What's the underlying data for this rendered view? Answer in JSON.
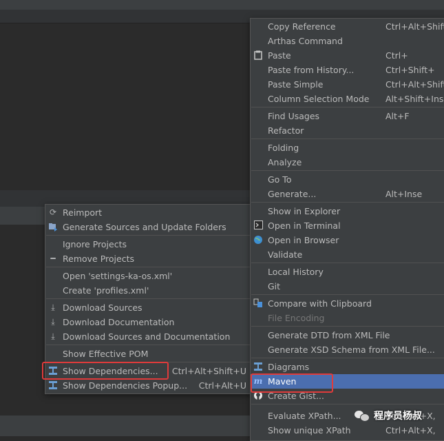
{
  "left_menu": {
    "items": [
      {
        "label": "Reimport",
        "icon": "refresh-icon",
        "shortcut": ""
      },
      {
        "label": "Generate Sources and Update Folders",
        "icon": "generate-folder-icon",
        "shortcut": ""
      },
      {
        "label": "Ignore Projects",
        "icon": "",
        "shortcut": ""
      },
      {
        "label": "Remove Projects",
        "icon": "minus-icon",
        "shortcut": ""
      },
      {
        "label": "Open 'settings-ka-os.xml'",
        "icon": "",
        "shortcut": ""
      },
      {
        "label": "Create 'profiles.xml'",
        "icon": "",
        "shortcut": ""
      },
      {
        "label": "Download Sources",
        "icon": "download-icon",
        "shortcut": ""
      },
      {
        "label": "Download Documentation",
        "icon": "download-icon",
        "shortcut": ""
      },
      {
        "label": "Download Sources and Documentation",
        "icon": "download-icon",
        "shortcut": ""
      },
      {
        "label": "Show Effective POM",
        "icon": "",
        "shortcut": ""
      },
      {
        "label": "Show Dependencies...",
        "icon": "dependencies-icon",
        "shortcut": "Ctrl+Alt+Shift+U"
      },
      {
        "label": "Show Dependencies Popup...",
        "icon": "dependencies-icon",
        "shortcut": "Ctrl+Alt+U"
      }
    ]
  },
  "right_menu": {
    "items": [
      {
        "label": "Copy Reference",
        "shortcut": "Ctrl+Alt+Shift+"
      },
      {
        "label": "Arthas Command",
        "shortcut": ""
      },
      {
        "label": "Paste",
        "shortcut": "Ctrl+"
      },
      {
        "label": "Paste from History...",
        "shortcut": "Ctrl+Shift+"
      },
      {
        "label": "Paste Simple",
        "shortcut": "Ctrl+Alt+Shift+"
      },
      {
        "label": "Column Selection Mode",
        "shortcut": "Alt+Shift+Inse"
      },
      {
        "label": "Find Usages",
        "shortcut": "Alt+F"
      },
      {
        "label": "Refactor",
        "shortcut": ""
      },
      {
        "label": "Folding",
        "shortcut": ""
      },
      {
        "label": "Analyze",
        "shortcut": ""
      },
      {
        "label": "Go To",
        "shortcut": ""
      },
      {
        "label": "Generate...",
        "shortcut": "Alt+Inse"
      },
      {
        "label": "Show in Explorer",
        "shortcut": ""
      },
      {
        "label": "Open in Terminal",
        "shortcut": ""
      },
      {
        "label": "Open in Browser",
        "shortcut": ""
      },
      {
        "label": "Validate",
        "shortcut": ""
      },
      {
        "label": "Local History",
        "shortcut": ""
      },
      {
        "label": "Git",
        "shortcut": ""
      },
      {
        "label": "Compare with Clipboard",
        "shortcut": ""
      },
      {
        "label": "File Encoding",
        "shortcut": ""
      },
      {
        "label": "Generate DTD from XML File",
        "shortcut": ""
      },
      {
        "label": "Generate XSD Schema from XML File...",
        "shortcut": ""
      },
      {
        "label": "Diagrams",
        "shortcut": ""
      },
      {
        "label": "Maven",
        "shortcut": ""
      },
      {
        "label": "Create Gist...",
        "shortcut": ""
      },
      {
        "label": "Evaluate XPath...",
        "shortcut": "Ctrl+Alt+X,"
      },
      {
        "label": "Show unique XPath",
        "shortcut": "Ctrl+Alt+X,"
      }
    ]
  },
  "watermark": {
    "text": "程序员杨叔"
  },
  "colors": {
    "menu_bg": "#3c3f41",
    "selected_bg": "#4b6eaf",
    "highlight_box": "#e03b3b",
    "text": "#bbbbbb"
  }
}
